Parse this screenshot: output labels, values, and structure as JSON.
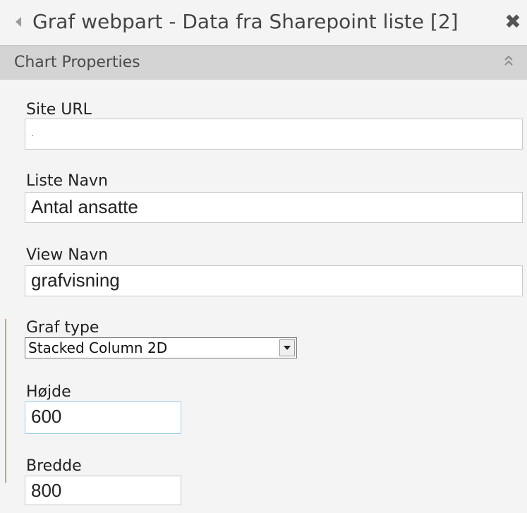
{
  "window": {
    "title": "Graf webpart - Data fra Sharepoint liste [2]",
    "close_glyph": "✖"
  },
  "section": {
    "title": "Chart Properties",
    "collapse_icon": "double-chevron-up-icon"
  },
  "fields": {
    "site_url": {
      "label": "Site URL",
      "value": "."
    },
    "liste_navn": {
      "label": "Liste Navn",
      "value": "Antal ansatte"
    },
    "view_navn": {
      "label": "View Navn",
      "value": "grafvisning"
    },
    "graf_type": {
      "label": "Graf type",
      "value": "Stacked Column 2D"
    },
    "hojde": {
      "label": "Højde",
      "value": "600"
    },
    "bredde": {
      "label": "Bredde",
      "value": "800"
    }
  },
  "colors": {
    "title_bar": "#f4f4f4",
    "section_header": "#d4d4d4",
    "body": "#f4f4f4",
    "focus_border": "#9ecbe8",
    "accent": "#d9a54d"
  }
}
